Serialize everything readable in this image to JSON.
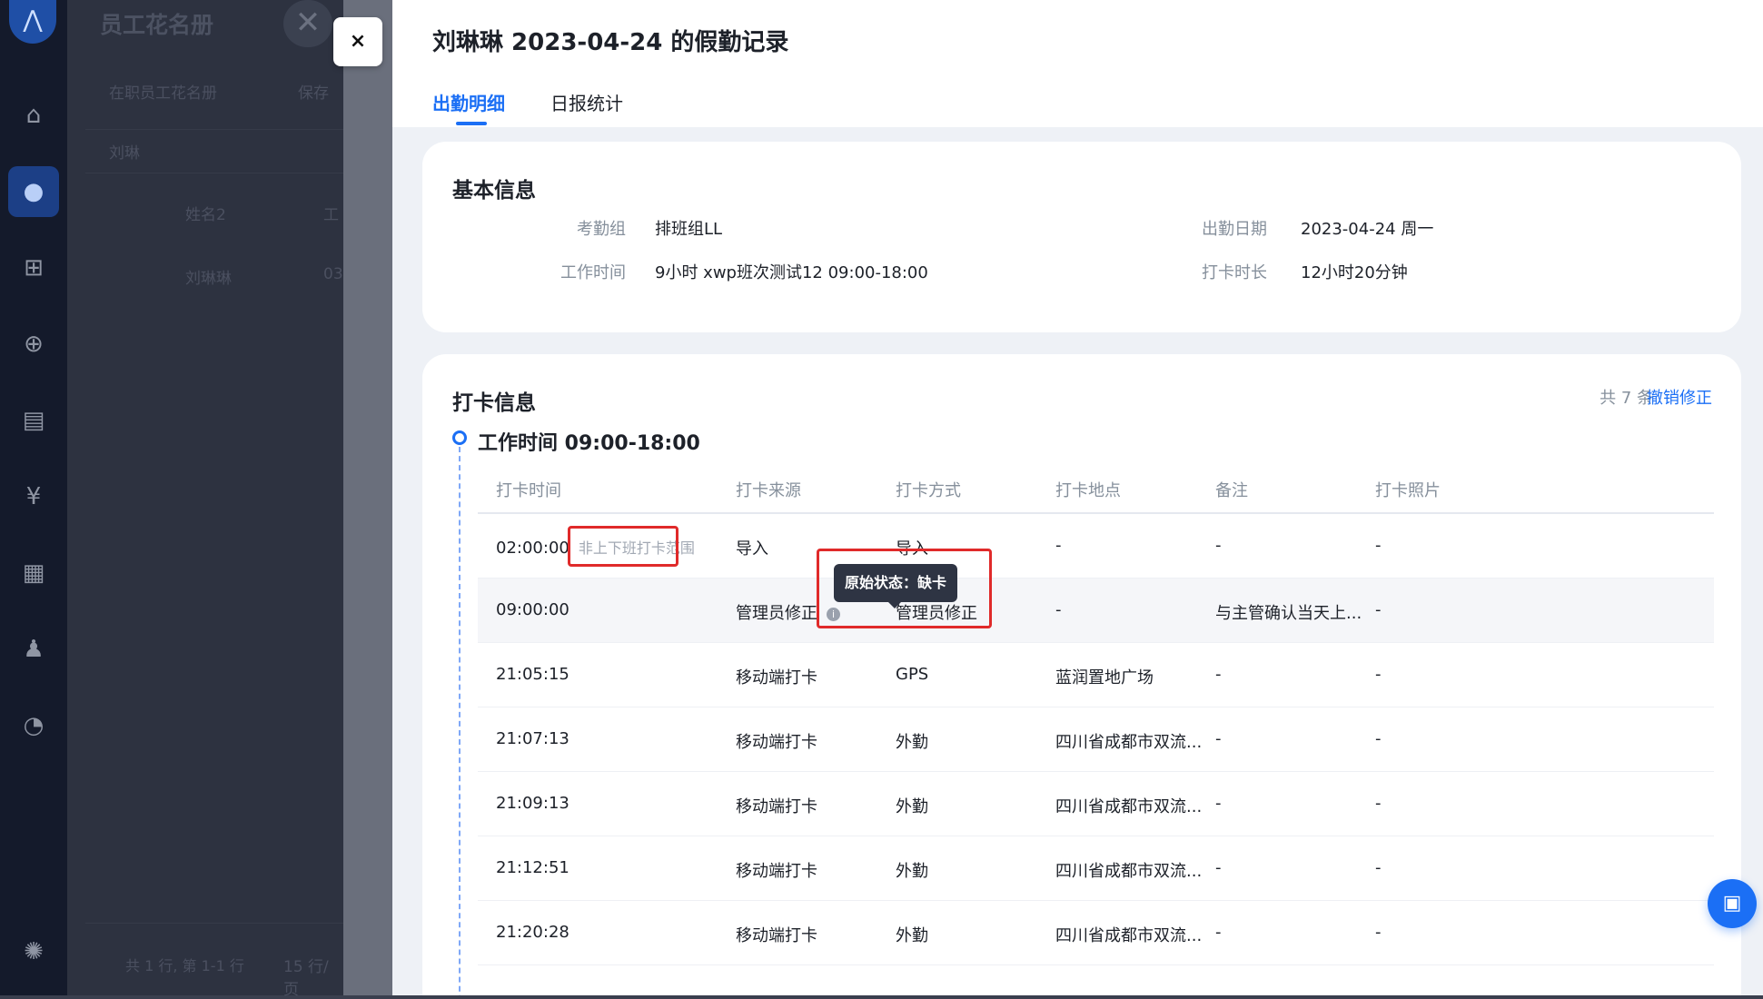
{
  "background": {
    "panel_title": "员工花名册",
    "filter_label": "在职员工花名册",
    "save_label": "保存",
    "search_value": "刘琳",
    "col_name": "姓名2",
    "col_short": "工",
    "row_name": "刘琳琳",
    "row_short": "03",
    "footer": "共 1 行, 第 1-1 行",
    "per_page": "15 行/页"
  },
  "drawer": {
    "title": "刘琳琳 2023-04-24 的假勤记录",
    "close_symbol": "×",
    "tabs": [
      "出勤明细",
      "日报统计"
    ]
  },
  "basic": {
    "title": "基本信息",
    "group_label": "考勤组",
    "group_value": "排班组LL",
    "date_label": "出勤日期",
    "date_value": "2023-04-24 周一",
    "worktime_label": "工作时间",
    "worktime_value": "9小时 xwp班次测试12 09:00-18:00",
    "duration_label": "打卡时长",
    "duration_value": "12小时20分钟"
  },
  "punch": {
    "title": "打卡信息",
    "count": "共 7 条",
    "revoke": "撤销修正",
    "worktime": "工作时间  09:00-18:00",
    "columns": [
      "打卡时间",
      "打卡来源",
      "打卡方式",
      "打卡地点",
      "备注",
      "打卡照片"
    ],
    "rows": [
      {
        "time": "02:00:00",
        "note": "非上下班打卡范围",
        "source": "导入",
        "method": "导入",
        "place": "-",
        "remark": "-",
        "photo": "-"
      },
      {
        "time": "09:00:00",
        "note": "",
        "source": "管理员修正",
        "method": "管理员修正",
        "place": "-",
        "remark": "与主管确认当天上...",
        "photo": "-"
      },
      {
        "time": "21:05:15",
        "note": "",
        "source": "移动端打卡",
        "method": "GPS",
        "place": "蓝润置地广场",
        "remark": "-",
        "photo": "-"
      },
      {
        "time": "21:07:13",
        "note": "",
        "source": "移动端打卡",
        "method": "外勤",
        "place": "四川省成都市双流...",
        "remark": "-",
        "photo": "-"
      },
      {
        "time": "21:09:13",
        "note": "",
        "source": "移动端打卡",
        "method": "外勤",
        "place": "四川省成都市双流...",
        "remark": "-",
        "photo": "-"
      },
      {
        "time": "21:12:51",
        "note": "",
        "source": "移动端打卡",
        "method": "外勤",
        "place": "四川省成都市双流...",
        "remark": "-",
        "photo": "-"
      },
      {
        "time": "21:20:28",
        "note": "",
        "source": "移动端打卡",
        "method": "外勤",
        "place": "四川省成都市双流...",
        "remark": "-",
        "photo": "-"
      }
    ],
    "tooltip": "原始状态：缺卡"
  },
  "icons": {
    "logo": "logo-icon",
    "home": "home-icon",
    "user": "user-icon",
    "org": "org-chart-icon",
    "user_add": "user-add-icon",
    "calendar": "calendar-icon",
    "money": "money-icon",
    "report": "report-icon",
    "person": "person-icon",
    "chart": "pie-chart-icon",
    "settings": "settings-icon",
    "chat": "chat-icon",
    "info": "info-icon"
  },
  "colors": {
    "accent": "#1b6ff5",
    "highlight_box": "#e02a2a",
    "tooltip_bg": "#2e3443"
  }
}
